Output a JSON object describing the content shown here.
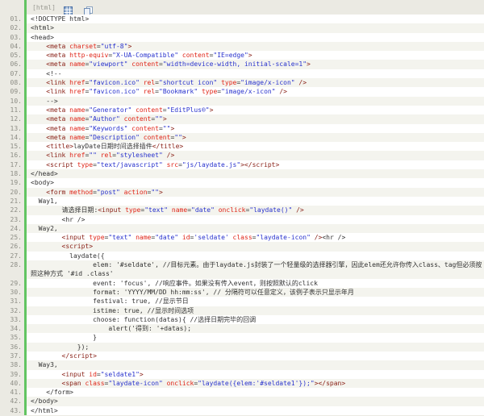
{
  "colors": {
    "container_bg": "#ebeae3",
    "row_bg": "#ffffff",
    "stripe_bg": "#f4f4ee",
    "green_bar": "#62c462",
    "plain_text": "#333333",
    "tag": "#8a2218",
    "attribute": "#e02518",
    "value": "#2832cd",
    "line_number": "#8d8d85",
    "toolbar_label": "#9b9b93",
    "icon_blue": "#4a6fa5"
  },
  "toolbar": {
    "lang_label": "[html]",
    "icons": [
      "view-plain-icon",
      "copy-icon"
    ]
  },
  "editor": {
    "lines": [
      {
        "n": "01.",
        "seg": [
          [
            "p",
            "<!DOCTYPE html>"
          ]
        ]
      },
      {
        "n": "02.",
        "seg": [
          [
            "p",
            "<html>"
          ]
        ]
      },
      {
        "n": "03.",
        "seg": [
          [
            "p",
            "<head>"
          ]
        ]
      },
      {
        "n": "04.",
        "seg": [
          [
            "p",
            "    "
          ],
          [
            "t",
            "<meta"
          ],
          [
            "a",
            " charset"
          ],
          [
            "p",
            "="
          ],
          [
            "v",
            "\"utf-8\""
          ],
          [
            "t",
            ">"
          ]
        ]
      },
      {
        "n": "05.",
        "seg": [
          [
            "p",
            "    "
          ],
          [
            "t",
            "<meta"
          ],
          [
            "a",
            " http-equiv"
          ],
          [
            "p",
            "="
          ],
          [
            "v",
            "\"X-UA-Compatible\""
          ],
          [
            "a",
            " content"
          ],
          [
            "p",
            "="
          ],
          [
            "v",
            "\"IE=edge\""
          ],
          [
            "t",
            ">"
          ]
        ]
      },
      {
        "n": "06.",
        "seg": [
          [
            "p",
            "    "
          ],
          [
            "t",
            "<meta"
          ],
          [
            "a",
            " name"
          ],
          [
            "p",
            "="
          ],
          [
            "v",
            "\"viewport\""
          ],
          [
            "a",
            " content"
          ],
          [
            "p",
            "="
          ],
          [
            "v",
            "\"width=device-width, initial-scale=1\""
          ],
          [
            "t",
            ">"
          ]
        ]
      },
      {
        "n": "07.",
        "seg": [
          [
            "p",
            "    <!--"
          ]
        ]
      },
      {
        "n": "08.",
        "seg": [
          [
            "p",
            "    "
          ],
          [
            "t",
            "<link"
          ],
          [
            "a",
            " href"
          ],
          [
            "p",
            "="
          ],
          [
            "v",
            "\"favicon.ico\""
          ],
          [
            "a",
            " rel"
          ],
          [
            "p",
            "="
          ],
          [
            "v",
            "\"shortcut icon\""
          ],
          [
            "a",
            " type"
          ],
          [
            "p",
            "="
          ],
          [
            "v",
            "\"image/x-icon\""
          ],
          [
            "t",
            " />"
          ]
        ]
      },
      {
        "n": "09.",
        "seg": [
          [
            "p",
            "    "
          ],
          [
            "t",
            "<link"
          ],
          [
            "a",
            " href"
          ],
          [
            "p",
            "="
          ],
          [
            "v",
            "\"favicon.ico\""
          ],
          [
            "a",
            " rel"
          ],
          [
            "p",
            "="
          ],
          [
            "v",
            "\"Bookmark\""
          ],
          [
            "a",
            " type"
          ],
          [
            "p",
            "="
          ],
          [
            "v",
            "\"image/x-icon\""
          ],
          [
            "t",
            " />"
          ]
        ]
      },
      {
        "n": "10.",
        "seg": [
          [
            "p",
            "    -->"
          ]
        ]
      },
      {
        "n": "11.",
        "seg": [
          [
            "p",
            "    "
          ],
          [
            "t",
            "<meta"
          ],
          [
            "a",
            " name"
          ],
          [
            "p",
            "="
          ],
          [
            "v",
            "\"Generator\""
          ],
          [
            "a",
            " content"
          ],
          [
            "p",
            "="
          ],
          [
            "v",
            "\"EditPlus®\""
          ],
          [
            "t",
            ">"
          ]
        ]
      },
      {
        "n": "12.",
        "seg": [
          [
            "p",
            "    "
          ],
          [
            "t",
            "<meta"
          ],
          [
            "a",
            " name"
          ],
          [
            "p",
            "="
          ],
          [
            "v",
            "\"Author\""
          ],
          [
            "a",
            " content"
          ],
          [
            "p",
            "="
          ],
          [
            "v",
            "\"\""
          ],
          [
            "t",
            ">"
          ]
        ]
      },
      {
        "n": "13.",
        "seg": [
          [
            "p",
            "    "
          ],
          [
            "t",
            "<meta"
          ],
          [
            "a",
            " name"
          ],
          [
            "p",
            "="
          ],
          [
            "v",
            "\"Keywords\""
          ],
          [
            "a",
            " content"
          ],
          [
            "p",
            "="
          ],
          [
            "v",
            "\"\""
          ],
          [
            "t",
            ">"
          ]
        ]
      },
      {
        "n": "14.",
        "seg": [
          [
            "p",
            "    "
          ],
          [
            "t",
            "<meta"
          ],
          [
            "a",
            " name"
          ],
          [
            "p",
            "="
          ],
          [
            "v",
            "\"Description\""
          ],
          [
            "a",
            " content"
          ],
          [
            "p",
            "="
          ],
          [
            "v",
            "\"\""
          ],
          [
            "t",
            ">"
          ]
        ]
      },
      {
        "n": "15.",
        "seg": [
          [
            "p",
            "    "
          ],
          [
            "t",
            "<title>"
          ],
          [
            "p",
            "layDate日期时间选择插件"
          ],
          [
            "t",
            "</title>"
          ]
        ]
      },
      {
        "n": "16.",
        "seg": [
          [
            "p",
            "    "
          ],
          [
            "t",
            "<link"
          ],
          [
            "a",
            " href"
          ],
          [
            "p",
            "="
          ],
          [
            "v",
            "\"\""
          ],
          [
            "a",
            " rel"
          ],
          [
            "p",
            "="
          ],
          [
            "v",
            "\"stylesheet\""
          ],
          [
            "t",
            " />"
          ]
        ]
      },
      {
        "n": "17.",
        "seg": [
          [
            "p",
            "    "
          ],
          [
            "t",
            "<script"
          ],
          [
            "a",
            " type"
          ],
          [
            "p",
            "="
          ],
          [
            "v",
            "\"text/javascript\""
          ],
          [
            "a",
            " src"
          ],
          [
            "p",
            "="
          ],
          [
            "v",
            "\"js/laydate.js\""
          ],
          [
            "t",
            "></script>"
          ]
        ]
      },
      {
        "n": "18.",
        "seg": [
          [
            "p",
            "</head>"
          ]
        ]
      },
      {
        "n": "19.",
        "seg": [
          [
            "p",
            "<body>"
          ]
        ]
      },
      {
        "n": "20.",
        "seg": [
          [
            "p",
            "    "
          ],
          [
            "t",
            "<form"
          ],
          [
            "a",
            " method"
          ],
          [
            "p",
            "="
          ],
          [
            "v",
            "\"post\""
          ],
          [
            "a",
            " action"
          ],
          [
            "p",
            "="
          ],
          [
            "v",
            "\"\""
          ],
          [
            "t",
            ">"
          ]
        ]
      },
      {
        "n": "21.",
        "seg": [
          [
            "p",
            "  Way1,"
          ]
        ]
      },
      {
        "n": "22.",
        "seg": [
          [
            "p",
            "        请选择日期:"
          ],
          [
            "t",
            "<input"
          ],
          [
            "a",
            " type"
          ],
          [
            "p",
            "="
          ],
          [
            "v",
            "\"text\""
          ],
          [
            "a",
            " name"
          ],
          [
            "p",
            "="
          ],
          [
            "v",
            "\"date\""
          ],
          [
            "a",
            " onclick"
          ],
          [
            "p",
            "="
          ],
          [
            "v",
            "\"laydate()\""
          ],
          [
            "t",
            " />"
          ]
        ]
      },
      {
        "n": "23.",
        "seg": [
          [
            "p",
            "        <hr />"
          ]
        ]
      },
      {
        "n": "24.",
        "seg": [
          [
            "p",
            "  Way2,"
          ]
        ]
      },
      {
        "n": "25.",
        "seg": [
          [
            "p",
            "        "
          ],
          [
            "t",
            "<input"
          ],
          [
            "a",
            " type"
          ],
          [
            "p",
            "="
          ],
          [
            "v",
            "\"text\""
          ],
          [
            "a",
            " name"
          ],
          [
            "p",
            "="
          ],
          [
            "v",
            "\"date\""
          ],
          [
            "a",
            " id"
          ],
          [
            "p",
            "="
          ],
          [
            "v",
            "'seldate'"
          ],
          [
            "a",
            " class"
          ],
          [
            "p",
            "="
          ],
          [
            "v",
            "\"laydate-icon\""
          ],
          [
            "t",
            " />"
          ],
          [
            "p",
            "<hr />"
          ]
        ]
      },
      {
        "n": "26.",
        "seg": [
          [
            "p",
            "        "
          ],
          [
            "t",
            "<script>"
          ]
        ]
      },
      {
        "n": "27.",
        "seg": [
          [
            "p",
            "          laydate({"
          ]
        ]
      },
      {
        "n": "28.",
        "seg": [
          [
            "p",
            "                elem: '#seldate', //目标元素。由于laydate.js封装了一个轻量级的选择器引擎，因此elem还允许你传入class、tag但必须按照这种方式 '#id .class'"
          ]
        ]
      },
      {
        "n": "29.",
        "seg": [
          [
            "p",
            "                event: 'focus', //响应事件。如果没有传入event，则按照默认的click"
          ]
        ]
      },
      {
        "n": "30.",
        "seg": [
          [
            "p",
            "                format: 'YYYY/MM/DD hh:mm:ss', // 分隔符可以任意定义，该例子表示只显示年月"
          ]
        ]
      },
      {
        "n": "31.",
        "seg": [
          [
            "p",
            "                festival: true, //显示节日"
          ]
        ]
      },
      {
        "n": "32.",
        "seg": [
          [
            "p",
            "                istime: true, //显示时间选项"
          ]
        ]
      },
      {
        "n": "33.",
        "seg": [
          [
            "p",
            "                choose: function(datas){ //选择日期完毕的回调"
          ]
        ]
      },
      {
        "n": "34.",
        "seg": [
          [
            "p",
            "                    alert('得到: '+datas);"
          ]
        ]
      },
      {
        "n": "35.",
        "seg": [
          [
            "p",
            "                }"
          ]
        ]
      },
      {
        "n": "36.",
        "seg": [
          [
            "p",
            "            });"
          ]
        ]
      },
      {
        "n": "37.",
        "seg": [
          [
            "p",
            "        "
          ],
          [
            "t",
            "</script>"
          ]
        ]
      },
      {
        "n": "38.",
        "seg": [
          [
            "p",
            "  Way3,"
          ]
        ]
      },
      {
        "n": "39.",
        "seg": [
          [
            "p",
            "        "
          ],
          [
            "t",
            "<input"
          ],
          [
            "a",
            " id"
          ],
          [
            "p",
            "="
          ],
          [
            "v",
            "\"seldate1\""
          ],
          [
            "t",
            ">"
          ]
        ]
      },
      {
        "n": "40.",
        "seg": [
          [
            "p",
            "        "
          ],
          [
            "t",
            "<span"
          ],
          [
            "a",
            " class"
          ],
          [
            "p",
            "="
          ],
          [
            "v",
            "\"laydate-icon\""
          ],
          [
            "a",
            " onclick"
          ],
          [
            "p",
            "="
          ],
          [
            "v",
            "\"laydate({elem:'#seldate1'});\""
          ],
          [
            "t",
            "></span>"
          ]
        ]
      },
      {
        "n": "41.",
        "seg": [
          [
            "p",
            "    </form>"
          ]
        ]
      },
      {
        "n": "42.",
        "seg": [
          [
            "p",
            "</body>"
          ]
        ]
      },
      {
        "n": "43.",
        "seg": [
          [
            "p",
            "</html>"
          ]
        ]
      }
    ]
  }
}
